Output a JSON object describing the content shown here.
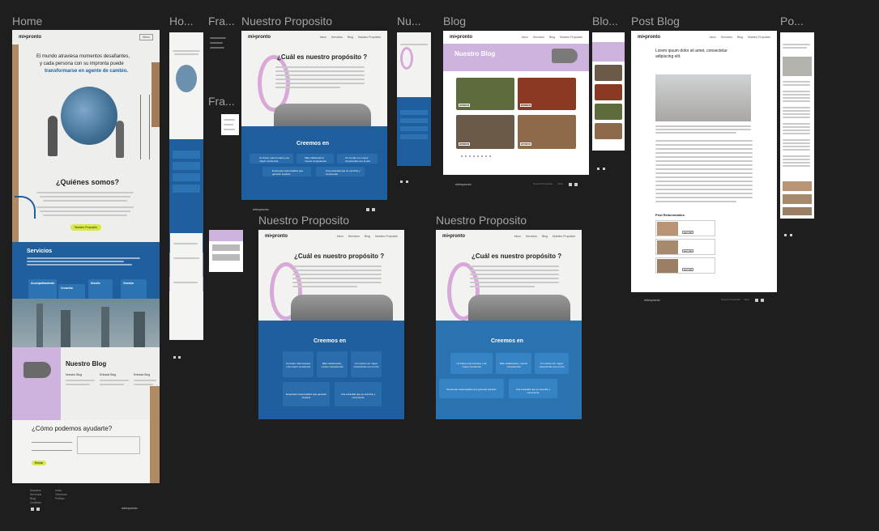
{
  "canvas": {
    "background": "#1e1e1e"
  },
  "frame_labels": {
    "home": "Home",
    "home_mobile": "Ho...",
    "fra1": "Fra...",
    "fra2": "Fra...",
    "proposito1": "Nuestro Proposito",
    "nu_mobile": "Nu...",
    "blog": "Blog",
    "blog_mobile": "Blo...",
    "post_blog": "Post Blog",
    "po_mobile": "Po...",
    "proposito2": "Nuestro Proposito",
    "proposito3": "Nuestro Proposito"
  },
  "brand": {
    "logo": "mi•pronto",
    "footer_logo": "miimpronto"
  },
  "home": {
    "nav_links": [
      "Menu"
    ],
    "hero_line1": "El mundo atraviesa momentos desafiantes,",
    "hero_line2": "y cada persona con su impronta puede",
    "hero_line3": "transformarse en agente de cambio.",
    "quienes_title": "¿Quiénes somos?",
    "quienes_button": "Nuestro Propósito",
    "servicios_title": "Servicios",
    "servicios_cards": [
      "Acompañamiento",
      "Creación",
      "Diseño",
      "Gestión"
    ],
    "blog_title": "Nuestro Blog",
    "blog_cols": [
      "Nuestro Blog",
      "Entrada Blog",
      "Entrada Blog"
    ],
    "ayudar_title": "¿Cómo podemos ayudarte?",
    "send_button": "Enviar",
    "footer_links": [
      "Nosotros",
      "Servicios",
      "Blog",
      "Contacto",
      "Inicio",
      "Términos",
      "Política"
    ]
  },
  "proposito": {
    "nav_links": [
      "Inicio",
      "Servicios",
      "Blog"
    ],
    "nav_cta": "Nuestro Propósito",
    "title": "¿Cuál es nuestro propósito ?",
    "creemos_title": "Creemos en",
    "cards": [
      "Un futuro más humano y de mayor conciencia",
      "Más colaboración, menos competencia",
      "Un mundo con mayor compromiso con el otro",
      "Empresas responsables que generan impacto",
      "Una sociedad que se escuche y comprende"
    ]
  },
  "blog": {
    "nav_links": [
      "Inicio",
      "Servicios",
      "Blog"
    ],
    "nav_cta": "Nuestro Propósito",
    "hero_title": "Nuestro Blog",
    "card_button": "Leer más",
    "footer_logo": "miimpronto",
    "footer_links": [
      "Nuestro Propósito",
      "Inicio"
    ]
  },
  "post": {
    "title_line1": "Lorem ipsum dolor sit amet, consectetur",
    "title_line2": "adipiscing elit.",
    "related_title": "Post Relacionados",
    "related_button": "Leer más",
    "footer_logo": "miimpronto",
    "footer_links": [
      "Nuestro Propósito",
      "Inicio"
    ]
  },
  "colors": {
    "blue": "#1f5f9e",
    "card_blue": "#2a6dac",
    "lavender": "#cdb3dd",
    "yellow": "#d8e84a",
    "dark_footer": "#1e1e1e"
  }
}
